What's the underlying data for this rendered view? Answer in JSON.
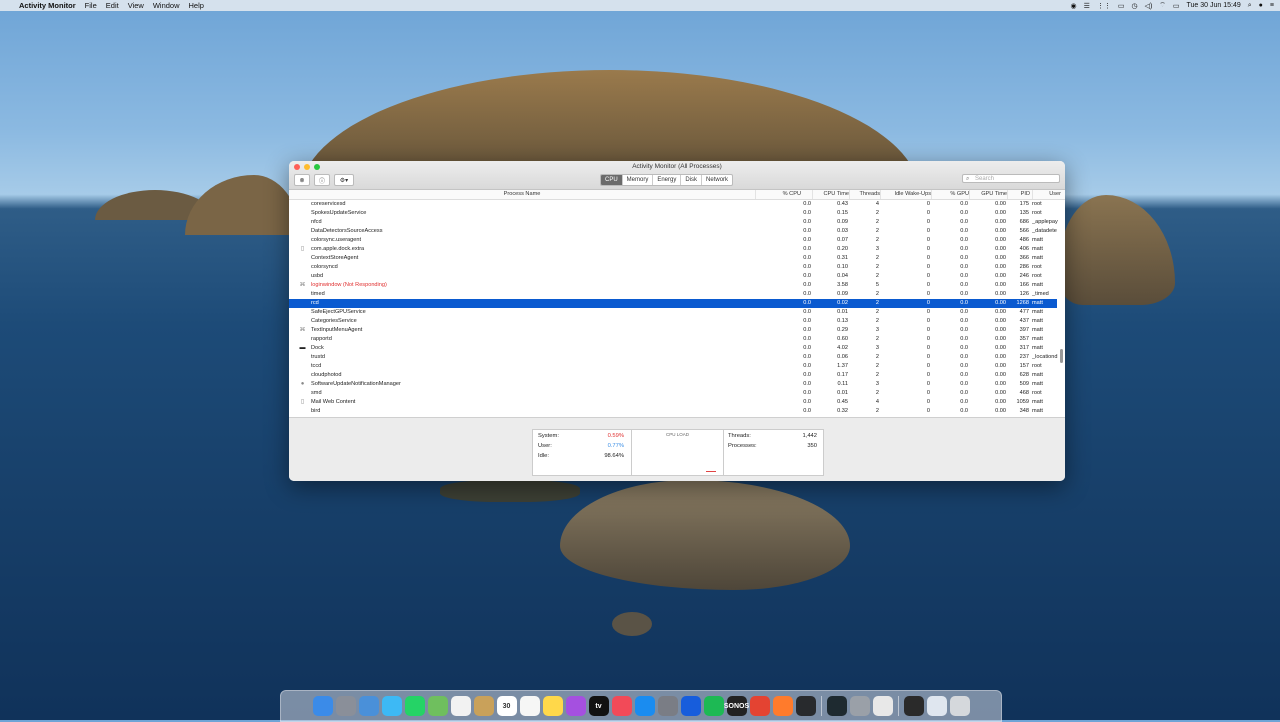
{
  "menubar": {
    "app": "Activity Monitor",
    "items": [
      "File",
      "Edit",
      "View",
      "Window",
      "Help"
    ],
    "datetime": "Tue 30 Jun  15:49"
  },
  "window": {
    "title": "Activity Monitor (All Processes)",
    "tabs": [
      "CPU",
      "Memory",
      "Energy",
      "Disk",
      "Network"
    ],
    "active_tab": "CPU",
    "search_placeholder": "Search"
  },
  "table": {
    "columns": [
      "Process Name",
      "% CPU",
      "CPU Time",
      "Threads",
      "Idle Wake-Ups",
      "% GPU",
      "GPU Time",
      "PID",
      "User"
    ],
    "rows": [
      {
        "name": "coreservicesd",
        "cpu": "0.0",
        "time": "0.43",
        "threads": "4",
        "idle": "0",
        "gpu": "0.0",
        "gtime": "0.00",
        "pid": "175",
        "user": "root"
      },
      {
        "name": "SpokesUpdateService",
        "cpu": "0.0",
        "time": "0.15",
        "threads": "2",
        "idle": "0",
        "gpu": "0.0",
        "gtime": "0.00",
        "pid": "135",
        "user": "root"
      },
      {
        "name": "nfcd",
        "cpu": "0.0",
        "time": "0.09",
        "threads": "2",
        "idle": "0",
        "gpu": "0.0",
        "gtime": "0.00",
        "pid": "686",
        "user": "_applepay"
      },
      {
        "name": "DataDetectorsSourceAccess",
        "cpu": "0.0",
        "time": "0.03",
        "threads": "2",
        "idle": "0",
        "gpu": "0.0",
        "gtime": "0.00",
        "pid": "566",
        "user": "_datadete"
      },
      {
        "name": "colorsync.useragent",
        "cpu": "0.0",
        "time": "0.07",
        "threads": "2",
        "idle": "0",
        "gpu": "0.0",
        "gtime": "0.00",
        "pid": "486",
        "user": "matt"
      },
      {
        "name": "com.apple.dock.extra",
        "cpu": "0.0",
        "time": "0.20",
        "threads": "3",
        "idle": "0",
        "gpu": "0.0",
        "gtime": "0.00",
        "pid": "406",
        "user": "matt",
        "icon": "doc"
      },
      {
        "name": "ContextStoreAgent",
        "cpu": "0.0",
        "time": "0.31",
        "threads": "2",
        "idle": "0",
        "gpu": "0.0",
        "gtime": "0.00",
        "pid": "366",
        "user": "matt"
      },
      {
        "name": "colorsyncd",
        "cpu": "0.0",
        "time": "0.10",
        "threads": "2",
        "idle": "0",
        "gpu": "0.0",
        "gtime": "0.00",
        "pid": "286",
        "user": "root"
      },
      {
        "name": "usbd",
        "cpu": "0.0",
        "time": "0.04",
        "threads": "2",
        "idle": "0",
        "gpu": "0.0",
        "gtime": "0.00",
        "pid": "246",
        "user": "root"
      },
      {
        "name": "loginwindow (Not Responding)",
        "cpu": "0.0",
        "time": "3.58",
        "threads": "5",
        "idle": "0",
        "gpu": "0.0",
        "gtime": "0.00",
        "pid": "166",
        "user": "matt",
        "icon": "app",
        "warn": true
      },
      {
        "name": "timed",
        "cpu": "0.0",
        "time": "0.09",
        "threads": "2",
        "idle": "0",
        "gpu": "0.0",
        "gtime": "0.00",
        "pid": "126",
        "user": "_timed"
      },
      {
        "name": "rcd",
        "cpu": "0.0",
        "time": "0.02",
        "threads": "2",
        "idle": "0",
        "gpu": "0.0",
        "gtime": "0.00",
        "pid": "1268",
        "user": "matt",
        "selected": true
      },
      {
        "name": "SafeEjectGPUService",
        "cpu": "0.0",
        "time": "0.01",
        "threads": "2",
        "idle": "0",
        "gpu": "0.0",
        "gtime": "0.00",
        "pid": "477",
        "user": "matt"
      },
      {
        "name": "CategoriesService",
        "cpu": "0.0",
        "time": "0.13",
        "threads": "2",
        "idle": "0",
        "gpu": "0.0",
        "gtime": "0.00",
        "pid": "437",
        "user": "matt"
      },
      {
        "name": "TextInputMenuAgent",
        "cpu": "0.0",
        "time": "0.29",
        "threads": "3",
        "idle": "0",
        "gpu": "0.0",
        "gtime": "0.00",
        "pid": "397",
        "user": "matt",
        "icon": "app"
      },
      {
        "name": "rapportd",
        "cpu": "0.0",
        "time": "0.60",
        "threads": "2",
        "idle": "0",
        "gpu": "0.0",
        "gtime": "0.00",
        "pid": "357",
        "user": "matt"
      },
      {
        "name": "Dock",
        "cpu": "0.0",
        "time": "4.02",
        "threads": "3",
        "idle": "0",
        "gpu": "0.0",
        "gtime": "0.00",
        "pid": "317",
        "user": "matt",
        "icon": "dock"
      },
      {
        "name": "trustd",
        "cpu": "0.0",
        "time": "0.06",
        "threads": "2",
        "idle": "0",
        "gpu": "0.0",
        "gtime": "0.00",
        "pid": "237",
        "user": "_locationd"
      },
      {
        "name": "tccd",
        "cpu": "0.0",
        "time": "1.37",
        "threads": "2",
        "idle": "0",
        "gpu": "0.0",
        "gtime": "0.00",
        "pid": "157",
        "user": "root"
      },
      {
        "name": "cloudphotod",
        "cpu": "0.0",
        "time": "0.17",
        "threads": "2",
        "idle": "0",
        "gpu": "0.0",
        "gtime": "0.00",
        "pid": "628",
        "user": "matt"
      },
      {
        "name": "SoftwareUpdateNotificationManager",
        "cpu": "0.0",
        "time": "0.11",
        "threads": "3",
        "idle": "0",
        "gpu": "0.0",
        "gtime": "0.00",
        "pid": "509",
        "user": "matt",
        "icon": "circle"
      },
      {
        "name": "smd",
        "cpu": "0.0",
        "time": "0.01",
        "threads": "2",
        "idle": "0",
        "gpu": "0.0",
        "gtime": "0.00",
        "pid": "468",
        "user": "root"
      },
      {
        "name": "Mail Web Content",
        "cpu": "0.0",
        "time": "0.45",
        "threads": "4",
        "idle": "0",
        "gpu": "0.0",
        "gtime": "0.00",
        "pid": "1059",
        "user": "matt",
        "icon": "doc"
      },
      {
        "name": "bird",
        "cpu": "0.0",
        "time": "0.32",
        "threads": "2",
        "idle": "0",
        "gpu": "0.0",
        "gtime": "0.00",
        "pid": "348",
        "user": "matt"
      }
    ]
  },
  "stats": {
    "system_label": "System:",
    "system_value": "0.59%",
    "user_label": "User:",
    "user_value": "0.77%",
    "idle_label": "Idle:",
    "idle_value": "98.64%",
    "cpu_load_label": "CPU LOAD",
    "threads_label": "Threads:",
    "threads_value": "1,442",
    "processes_label": "Processes:",
    "processes_value": "350"
  },
  "colors": {
    "system": "#e03030",
    "user": "#3a8ee6",
    "selection": "#0a5ad0"
  },
  "dock": {
    "icons": [
      {
        "name": "finder",
        "color": "#3b8be8",
        "label": ""
      },
      {
        "name": "launchpad",
        "color": "#8a8f99",
        "label": ""
      },
      {
        "name": "mail",
        "color": "#4a90d9",
        "label": ""
      },
      {
        "name": "messages",
        "color": "#3db9f5",
        "label": ""
      },
      {
        "name": "whatsapp",
        "color": "#25d366",
        "label": ""
      },
      {
        "name": "maps",
        "color": "#6fbf5e",
        "label": ""
      },
      {
        "name": "photos",
        "color": "#f2f2f2",
        "label": ""
      },
      {
        "name": "notefile",
        "color": "#c9a15a",
        "label": ""
      },
      {
        "name": "calendar",
        "color": "#ffffff",
        "label": "30"
      },
      {
        "name": "reminders",
        "color": "#f6f6f6",
        "label": ""
      },
      {
        "name": "notes",
        "color": "#ffd84a",
        "label": ""
      },
      {
        "name": "podcasts",
        "color": "#a550e0",
        "label": ""
      },
      {
        "name": "apple-tv",
        "color": "#111111",
        "label": "tv"
      },
      {
        "name": "news",
        "color": "#f24a58",
        "label": ""
      },
      {
        "name": "app-store",
        "color": "#1a8cf0",
        "label": ""
      },
      {
        "name": "system-preferences",
        "color": "#7a7d85",
        "label": ""
      },
      {
        "name": "bitwarden",
        "color": "#175ddc",
        "label": ""
      },
      {
        "name": "spotify",
        "color": "#1db954",
        "label": ""
      },
      {
        "name": "sonos",
        "color": "#222222",
        "label": "SONOS"
      },
      {
        "name": "todoist",
        "color": "#e44332",
        "label": ""
      },
      {
        "name": "firefox",
        "color": "#ff7b2c",
        "label": ""
      },
      {
        "name": "plex",
        "color": "#282a2d",
        "label": ""
      },
      {
        "name": "activity-monitor",
        "color": "#1e2a30",
        "label": ""
      },
      {
        "name": "disk-utility",
        "color": "#9aa0a8",
        "label": ""
      },
      {
        "name": "preview",
        "color": "#e8e8e8",
        "label": ""
      },
      {
        "name": "plex-folder",
        "color": "#2a2a2a",
        "label": ""
      },
      {
        "name": "downloads",
        "color": "#dfe6ef",
        "label": ""
      },
      {
        "name": "trash",
        "color": "#d5d8dc",
        "label": ""
      }
    ]
  }
}
